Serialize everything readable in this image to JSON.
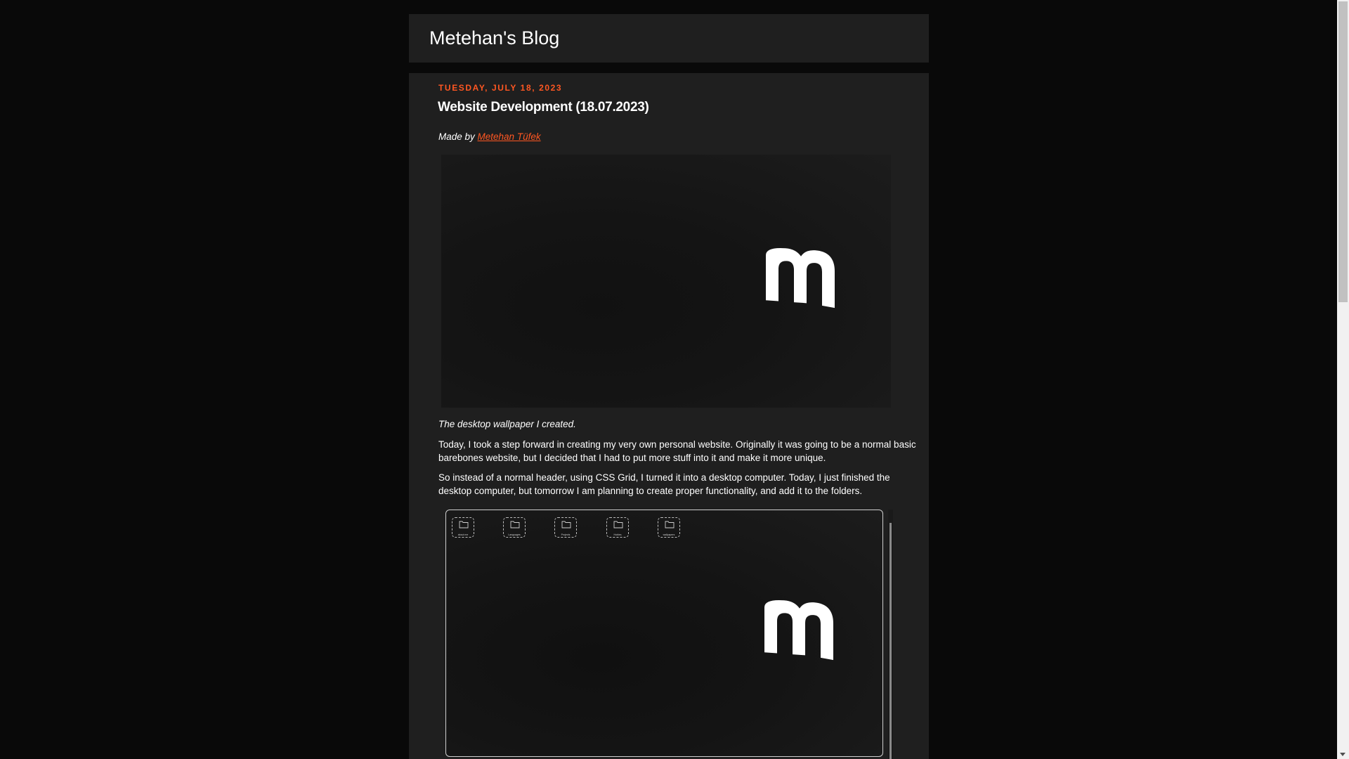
{
  "blog": {
    "title": "Metehan's Blog"
  },
  "post": {
    "date": "TUESDAY, JULY 18, 2023",
    "title": "Website Development (18.07.2023)",
    "byline_prefix": "Made by ",
    "author": "Metehan Tüfek",
    "image_caption": "The desktop wallpaper I created.",
    "paragraphs": [
      "Today, I took a step forward in creating my very own personal website. Originally it was going to be a normal basic barebones website, but I decided that I had to put more stuff into it and make it more unique.",
      "So instead of a normal header, using CSS Grid, I turned it into a desktop computer. Today, I just finished the desktop computer, but tomorrow I am planning to create proper functionality, and add it to the folders."
    ],
    "desktop_folders": [
      {
        "label": "about me",
        "icon": "folder-icon"
      },
      {
        "label": "Languages",
        "icon": "folder-icon"
      },
      {
        "label": "Projects",
        "icon": "folder-icon"
      },
      {
        "label": "Hobies",
        "icon": "folder-icon"
      },
      {
        "label": "wallpapers",
        "icon": "folder-icon"
      }
    ]
  },
  "colors": {
    "background": "#090909",
    "panel": "#1f1f1f",
    "accent": "#ff5722",
    "text": "#ffffff"
  },
  "icons": {
    "logo": "m-logo-icon",
    "folder": "folder-icon",
    "scroll_down": "scroll-down-arrow-icon"
  }
}
